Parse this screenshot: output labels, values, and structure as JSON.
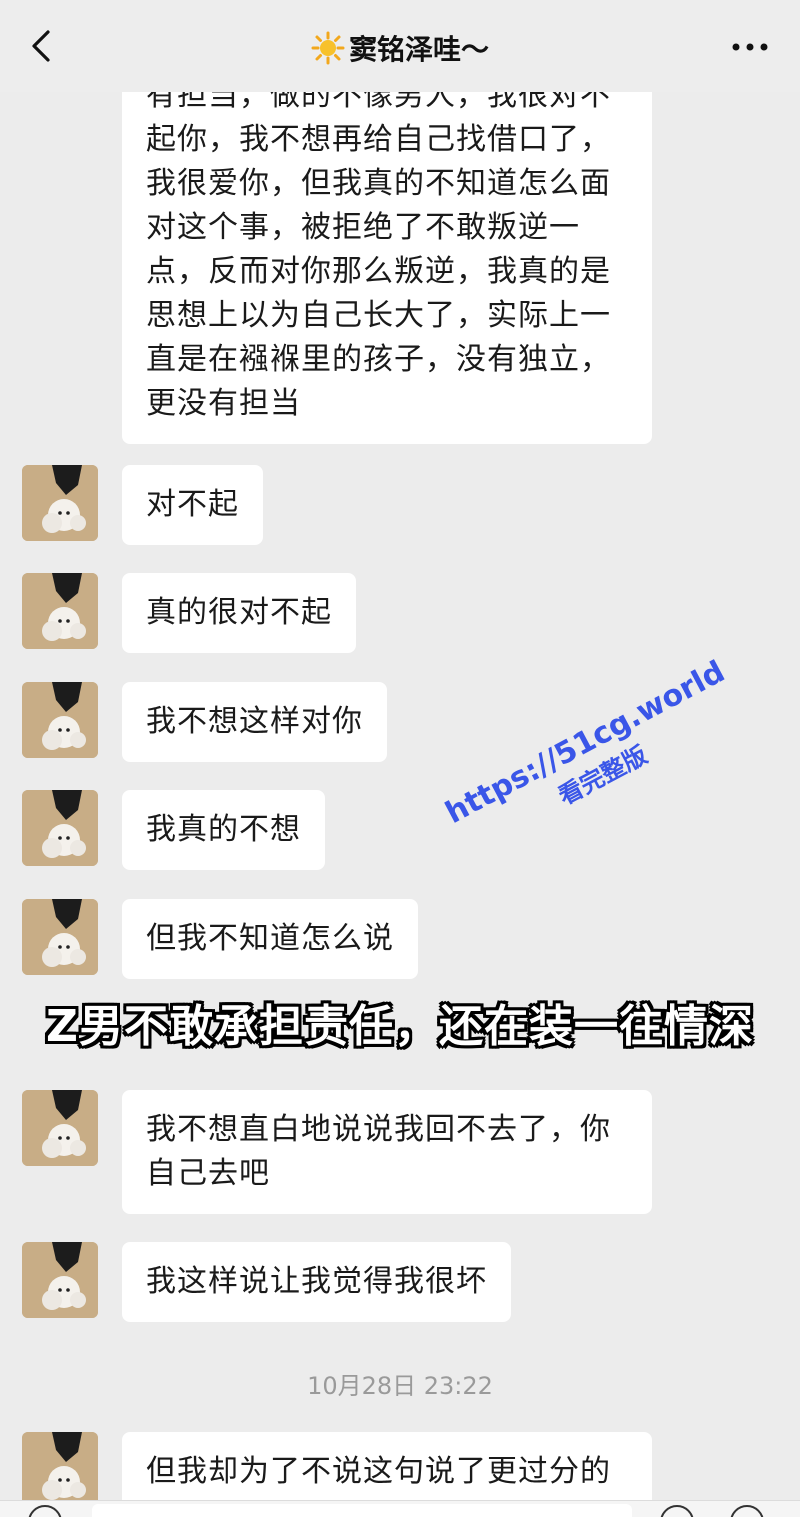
{
  "header": {
    "title": "窦铭泽哇～",
    "back_icon": "chevron-left-icon",
    "more_icon": "more-dots-icon"
  },
  "messages": [
    {
      "text": "有担当，做的不像男人，我很对不起你，我不想再给自己找借口了，我很爱你，但我真的不知道怎么面对这个事，被拒绝了不敢叛逆一点，反而对你那么叛逆，我真的是思想上以为自己长大了，实际上一直是在襁褓里的孩子，没有独立，更没有担当"
    },
    {
      "text": "对不起"
    },
    {
      "text": "真的很对不起"
    },
    {
      "text": "我不想这样对你"
    },
    {
      "text": "我真的不想"
    },
    {
      "text": "但我不知道怎么说"
    },
    {
      "text": "我不想直白地说说我回不去了，你自己去吧"
    },
    {
      "text": "我这样说让我觉得我很坏"
    },
    {
      "text": "但我却为了不说这句说了更过分的"
    }
  ],
  "timestamp": "10月28日 23:22",
  "caption": "Z男不敢承担责任，还在装一往情深",
  "watermark": {
    "url": "https://51cg.world",
    "sub": "看完整版"
  },
  "colors": {
    "background": "#ececec",
    "bubble": "#ffffff",
    "watermark": "#3a56e8"
  }
}
